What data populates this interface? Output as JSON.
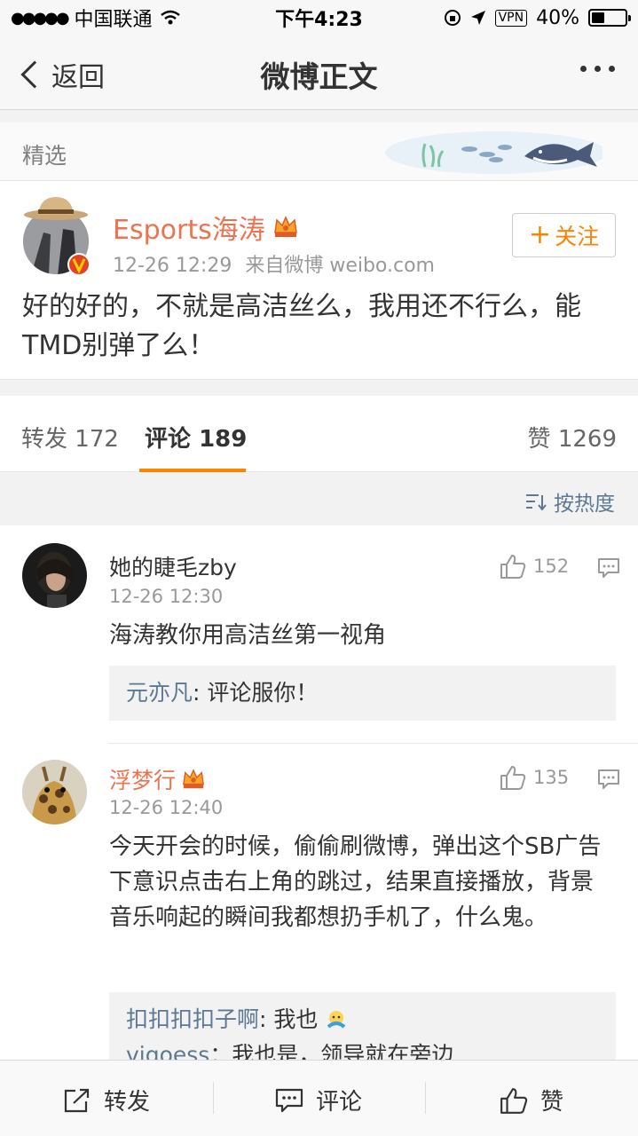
{
  "status_bar": {
    "carrier": "中国联通",
    "time": "下午4:23",
    "vpn": "VPN",
    "battery": "40%",
    "battery_level": 0.4
  },
  "nav": {
    "back_label": "返回",
    "title": "微博正文"
  },
  "featured": {
    "label": "精选"
  },
  "post": {
    "author": "Esports海涛",
    "time": "12-26 12:29",
    "source": "来自微博 weibo.com",
    "follow_label": "关注",
    "text": "好的好的，不就是高洁丝么，我用还不行么，能TMD别弹了么！"
  },
  "tabs": {
    "repost_label": "转发",
    "repost_count": "172",
    "comment_label": "评论",
    "comment_count": "189",
    "like_label": "赞",
    "like_count": "1269"
  },
  "sort": {
    "label": "按热度"
  },
  "comments": [
    {
      "name": "她的睫毛zby",
      "time": "12-26 12:30",
      "likes": "152",
      "text": "海涛教你用高洁丝第一视角",
      "replies": [
        {
          "user": "元亦凡",
          "text": ": 评论服你！"
        }
      ]
    },
    {
      "name": "浮梦行",
      "time": "12-26 12:40",
      "likes": "135",
      "text": "今天开会的时候，偷偷刷微博，弹出这个SB广告下意识点击右上角的跳过，结果直接播放，背景音乐响起的瞬间我都想扔手机了，什么鬼。",
      "replies": [
        {
          "user": "扣扣扣扣子啊",
          "text": ": 我也"
        },
        {
          "user": "viqoess",
          "text": "：我也是，领导就在旁边"
        }
      ]
    }
  ],
  "bottom_bar": {
    "repost_label": "转发",
    "comment_label": "评论",
    "like_label": "赞"
  },
  "colors": {
    "accent": "#ff8200",
    "username_orange": "#eb7350",
    "link_blue": "#5d7895"
  }
}
